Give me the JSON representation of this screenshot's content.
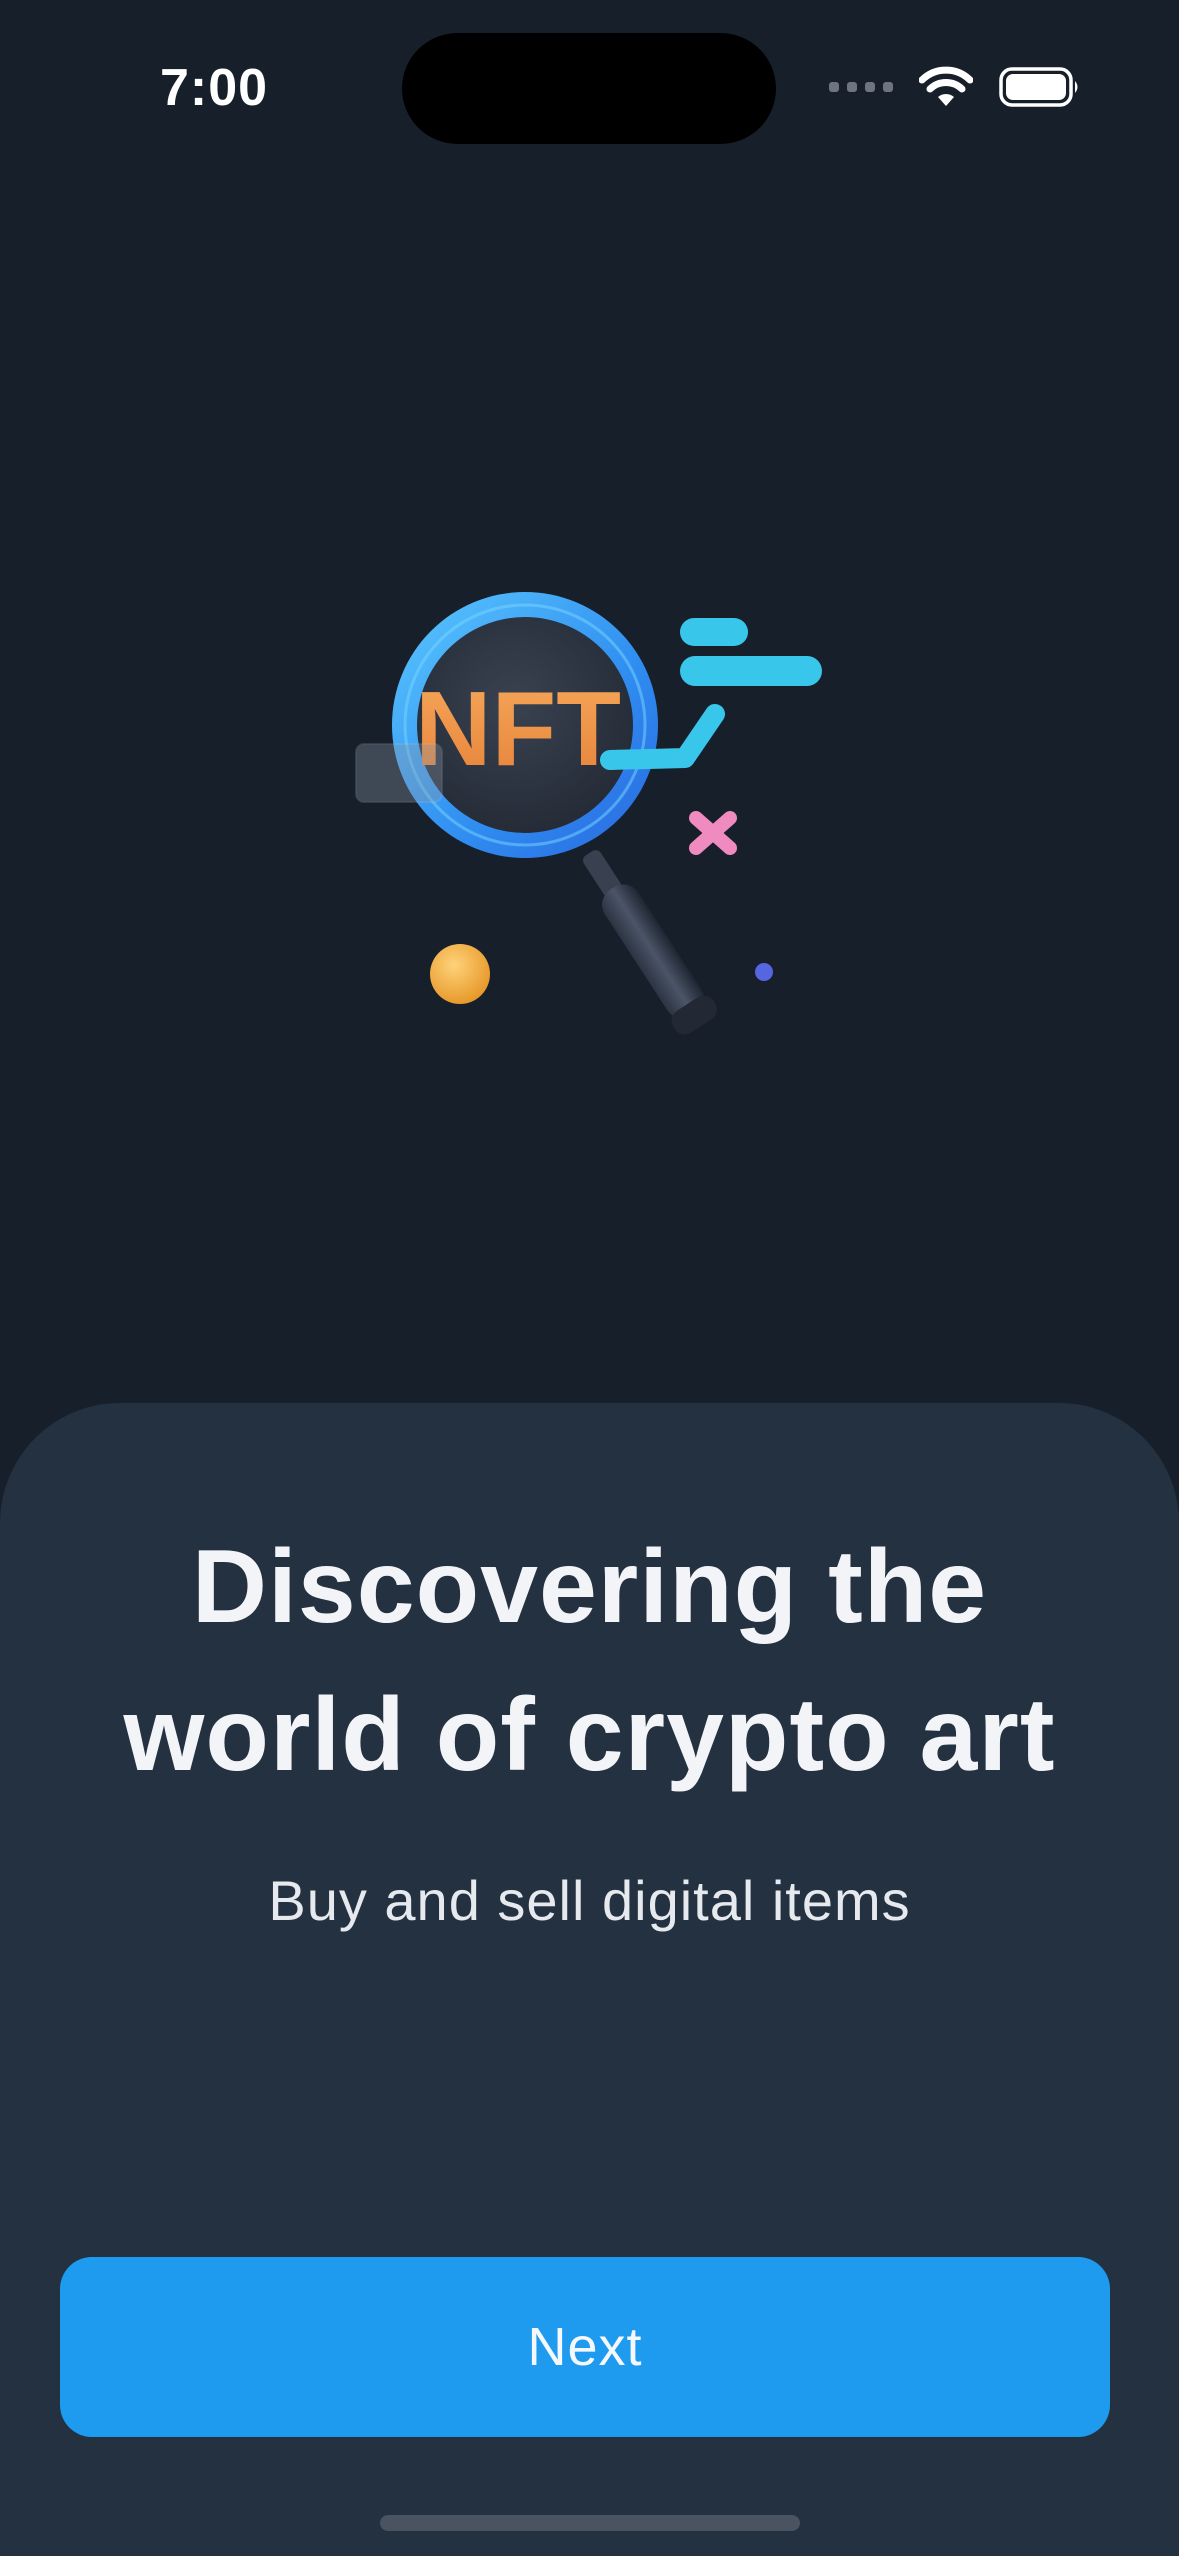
{
  "status_bar": {
    "time": "7:00",
    "icons": [
      "signal-dots-icon",
      "wifi-icon",
      "battery-icon"
    ]
  },
  "illustration": {
    "logo_text": "NFT",
    "icon": "nft-magnifier-illustration"
  },
  "onboarding": {
    "title": "Discovering the world of crypto art",
    "subtitle": "Buy and sell digital items",
    "next_label": "Next"
  },
  "colors": {
    "background": "#171f2a",
    "sheet": "#243140",
    "accent": "#1e9bee",
    "text": "#f2f4f7"
  }
}
